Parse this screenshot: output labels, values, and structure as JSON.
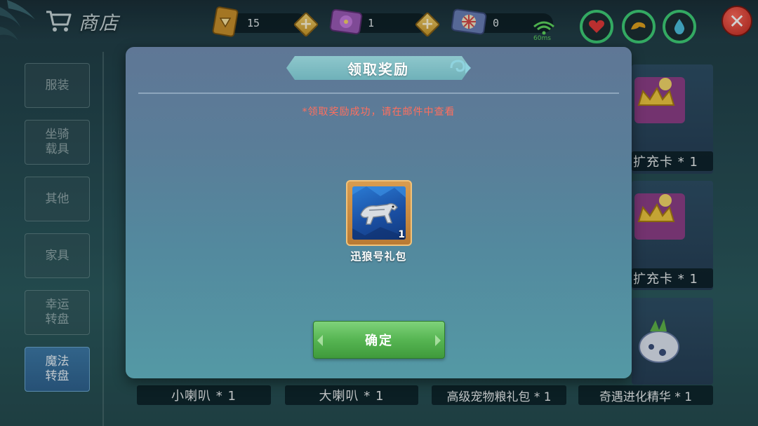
{
  "header": {
    "title": "商店",
    "currencies": [
      {
        "icon": "diamond-card-icon",
        "amount": "15"
      },
      {
        "icon": "purple-flower-ticket-icon",
        "amount": "1"
      },
      {
        "icon": "wheel-ticket-icon",
        "amount": "0"
      }
    ],
    "ping": "60ms",
    "stats": [
      {
        "icon": "heart-icon",
        "color": "#e23a3a"
      },
      {
        "icon": "food-icon",
        "color": "#e0a21e"
      },
      {
        "icon": "water-drop-icon",
        "color": "#4cc0de"
      }
    ]
  },
  "sidebar": {
    "tabs": [
      {
        "label": "服装",
        "active": false
      },
      {
        "label": "坐骑\n载具",
        "active": false
      },
      {
        "label": "其他",
        "active": false
      },
      {
        "label": "家具",
        "active": false
      },
      {
        "label": "幸运\n转盘",
        "active": false
      },
      {
        "label": "魔法\n转盘",
        "active": true
      }
    ]
  },
  "background_items": [
    {
      "label": "扩充卡 * 1"
    },
    {
      "label": "扩充卡 * 1"
    },
    {
      "label": "小喇叭 * 1"
    },
    {
      "label": "大喇叭 * 1"
    },
    {
      "label": "高级宠物粮礼包 * 1"
    },
    {
      "label": "奇遇进化精华 * 1"
    }
  ],
  "modal": {
    "title": "领取奖励",
    "notice": "*领取奖励成功，请在邮件中查看",
    "reward": {
      "name": "迅狼号礼包",
      "count": "1",
      "icon": "wolf-vehicle-icon"
    },
    "confirm_label": "确定"
  },
  "colors": {
    "notice": "#ff6f5e",
    "confirm": "#56b552",
    "active_tab": "#3d7aa8",
    "close": "#d9362a"
  }
}
